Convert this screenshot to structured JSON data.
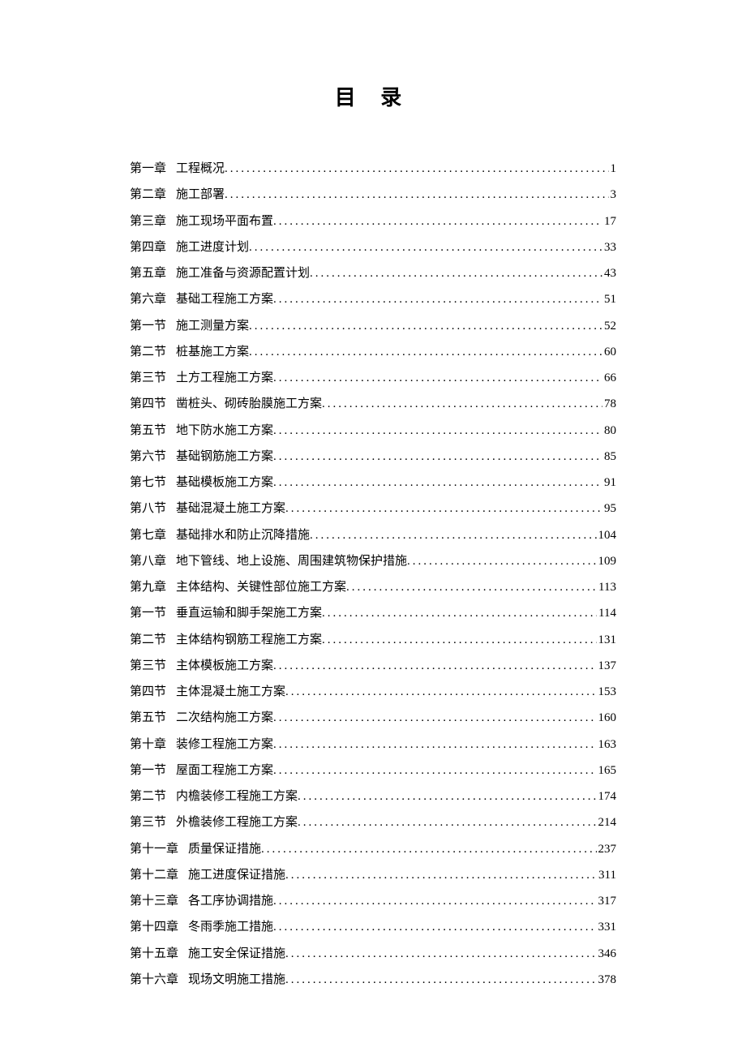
{
  "title": "目 录",
  "entries": [
    {
      "label": "第一章",
      "text": "工程概况",
      "page": "1"
    },
    {
      "label": "第二章",
      "text": "施工部署",
      "page": "3"
    },
    {
      "label": "第三章",
      "text": "施工现场平面布置",
      "page": "17"
    },
    {
      "label": "第四章",
      "text": "施工进度计划",
      "page": "33"
    },
    {
      "label": "第五章",
      "text": "施工准备与资源配置计划",
      "page": "43"
    },
    {
      "label": "第六章",
      "text": "基础工程施工方案",
      "page": "51"
    },
    {
      "label": "第一节",
      "text": "施工测量方案",
      "page": "52"
    },
    {
      "label": "第二节",
      "text": "桩基施工方案",
      "page": "60"
    },
    {
      "label": "第三节",
      "text": "土方工程施工方案",
      "page": "66"
    },
    {
      "label": "第四节",
      "text": "凿桩头、砌砖胎膜施工方案",
      "page": "78"
    },
    {
      "label": "第五节",
      "text": "地下防水施工方案",
      "page": "80"
    },
    {
      "label": "第六节",
      "text": "基础钢筋施工方案",
      "page": "85"
    },
    {
      "label": "第七节",
      "text": "基础模板施工方案",
      "page": "91"
    },
    {
      "label": "第八节",
      "text": "基础混凝土施工方案",
      "page": "95"
    },
    {
      "label": "第七章",
      "text": "基础排水和防止沉降措施",
      "page": "104"
    },
    {
      "label": "第八章",
      "text": "地下管线、地上设施、周围建筑物保护措施",
      "page": "109"
    },
    {
      "label": "第九章",
      "text": "主体结构、关键性部位施工方案",
      "page": "113"
    },
    {
      "label": "第一节",
      "text": "垂直运输和脚手架施工方案",
      "page": "114"
    },
    {
      "label": "第二节",
      "text": "主体结构钢筋工程施工方案",
      "page": "131"
    },
    {
      "label": "第三节",
      "text": "主体模板施工方案",
      "page": "137"
    },
    {
      "label": "第四节",
      "text": "主体混凝土施工方案",
      "page": "153"
    },
    {
      "label": "第五节",
      "text": "二次结构施工方案",
      "page": "160"
    },
    {
      "label": "第十章",
      "text": "装修工程施工方案",
      "page": "163"
    },
    {
      "label": "第一节",
      "text": "屋面工程施工方案",
      "page": "165"
    },
    {
      "label": "第二节",
      "text": "内檐装修工程施工方案",
      "page": "174"
    },
    {
      "label": "第三节",
      "text": "外檐装修工程施工方案",
      "page": "214"
    },
    {
      "label": "第十一章",
      "text": "质量保证措施",
      "page": "237"
    },
    {
      "label": "第十二章",
      "text": "施工进度保证措施",
      "page": "311"
    },
    {
      "label": "第十三章",
      "text": "各工序协调措施",
      "page": "317"
    },
    {
      "label": "第十四章",
      "text": "冬雨季施工措施",
      "page": "331"
    },
    {
      "label": "第十五章",
      "text": "施工安全保证措施",
      "page": "346"
    },
    {
      "label": "第十六章",
      "text": "现场文明施工措施",
      "page": "378"
    }
  ]
}
